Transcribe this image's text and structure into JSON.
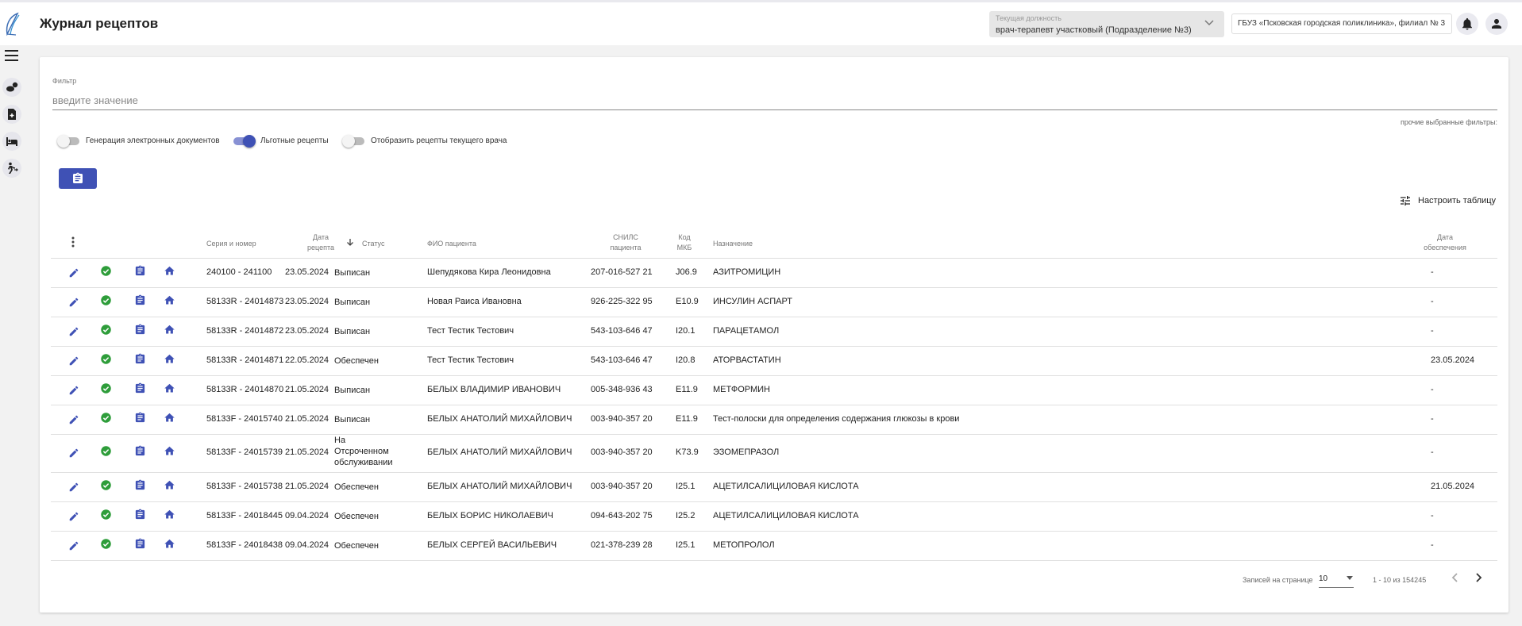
{
  "app": {
    "title": "Журнал рецептов"
  },
  "header": {
    "role_label": "Текущая должность",
    "role_value": "врач-терапевт участковый (Подразделение №3)",
    "organization": "ГБУЗ «Псковская городская поликлиника», филиал № 3"
  },
  "filter": {
    "label": "Фильтр",
    "placeholder": "введите значение",
    "other_filters": "прочие выбранные фильтры:"
  },
  "toggles": [
    {
      "label": "Генерация электронных документов",
      "on": false
    },
    {
      "label": "Льготные рецепты",
      "on": true
    },
    {
      "label": "Отобразить рецепты текущего врача",
      "on": false
    }
  ],
  "table_config_label": "Настроить таблицу",
  "columns": {
    "series": "Серия и номер",
    "date_1": "Дата",
    "date_2": "рецепта",
    "status": "Статус",
    "patient": "ФИО пациента",
    "snils_1": "СНИЛС",
    "snils_2": "пациента",
    "mkb_1": "Код",
    "mkb_2": "МКБ",
    "drug": "Назначение",
    "supply_1": "Дата",
    "supply_2": "обеспечения"
  },
  "rows": [
    {
      "series": "240100 - 241100",
      "date": "23.05.2024",
      "status": "Выписан",
      "patient": "Шепудякова Кира Леонидовна",
      "snils": "207-016-527 21",
      "mkb": "J06.9",
      "drug": "АЗИТРОМИЦИН",
      "supply": "-"
    },
    {
      "series": "58133R - 24014873",
      "date": "23.05.2024",
      "status": "Выписан",
      "patient": "Новая Раиса Ивановна",
      "snils": "926-225-322 95",
      "mkb": "E10.9",
      "drug": "ИНСУЛИН АСПАРТ",
      "supply": "-"
    },
    {
      "series": "58133R - 24014872",
      "date": "23.05.2024",
      "status": "Выписан",
      "patient": "Тест Тестик Тестович",
      "snils": "543-103-646 47",
      "mkb": "I20.1",
      "drug": "ПАРАЦЕТАМОЛ",
      "supply": "-"
    },
    {
      "series": "58133R - 24014871",
      "date": "22.05.2024",
      "status": "Обеспечен",
      "patient": "Тест Тестик Тестович",
      "snils": "543-103-646 47",
      "mkb": "I20.8",
      "drug": "АТОРВАСТАТИН",
      "supply": "23.05.2024"
    },
    {
      "series": "58133R - 24014870",
      "date": "21.05.2024",
      "status": "Выписан",
      "patient": "БЕЛЫХ ВЛАДИМИР ИВАНОВИЧ",
      "snils": "005-348-936 43",
      "mkb": "E11.9",
      "drug": "МЕТФОРМИН",
      "supply": "-"
    },
    {
      "series": "58133F - 24015740",
      "date": "21.05.2024",
      "status": "Выписан",
      "patient": "БЕЛЫХ АНАТОЛИЙ МИХАЙЛОВИЧ",
      "snils": "003-940-357 20",
      "mkb": "E11.9",
      "drug": "Тест-полоски для определения содержания глюкозы в крови",
      "supply": "-"
    },
    {
      "series": "58133F - 24015739",
      "date": "21.05.2024",
      "status": "На Отсроченном обслуживании",
      "patient": "БЕЛЫХ АНАТОЛИЙ МИХАЙЛОВИЧ",
      "snils": "003-940-357 20",
      "mkb": "K73.9",
      "drug": "ЭЗОМЕПРАЗОЛ",
      "supply": "-"
    },
    {
      "series": "58133F - 24015738",
      "date": "21.05.2024",
      "status": "Обеспечен",
      "patient": "БЕЛЫХ АНАТОЛИЙ МИХАЙЛОВИЧ",
      "snils": "003-940-357 20",
      "mkb": "I25.1",
      "drug": "АЦЕТИЛСАЛИЦИЛОВАЯ КИСЛОТА",
      "supply": "21.05.2024"
    },
    {
      "series": "58133F - 24018445",
      "date": "09.04.2024",
      "status": "Обеспечен",
      "patient": "БЕЛЫХ БОРИС НИКОЛАЕВИЧ",
      "snils": "094-643-202 75",
      "mkb": "I25.2",
      "drug": "АЦЕТИЛСАЛИЦИЛОВАЯ КИСЛОТА",
      "supply": "-"
    },
    {
      "series": "58133F - 24018438",
      "date": "09.04.2024",
      "status": "Обеспечен",
      "patient": "БЕЛЫХ СЕРГЕЙ ВАСИЛЬЕВИЧ",
      "snils": "021-378-239 28",
      "mkb": "I25.1",
      "drug": "МЕТОПРОЛОЛ",
      "supply": "-"
    }
  ],
  "pagination": {
    "per_page_label": "Записей на странице",
    "per_page_value": "10",
    "range": "1 - 10 из 154245"
  },
  "colors": {
    "accent": "#3f51b5",
    "ok": "#2e9d3a"
  },
  "icons": {
    "row": [
      "pencil-icon",
      "check-circle-icon",
      "clipboard-icon",
      "home-icon"
    ],
    "sidebar": [
      "pills-icon",
      "document-plus-icon",
      "bed-icon",
      "walking-person-icon"
    ]
  }
}
